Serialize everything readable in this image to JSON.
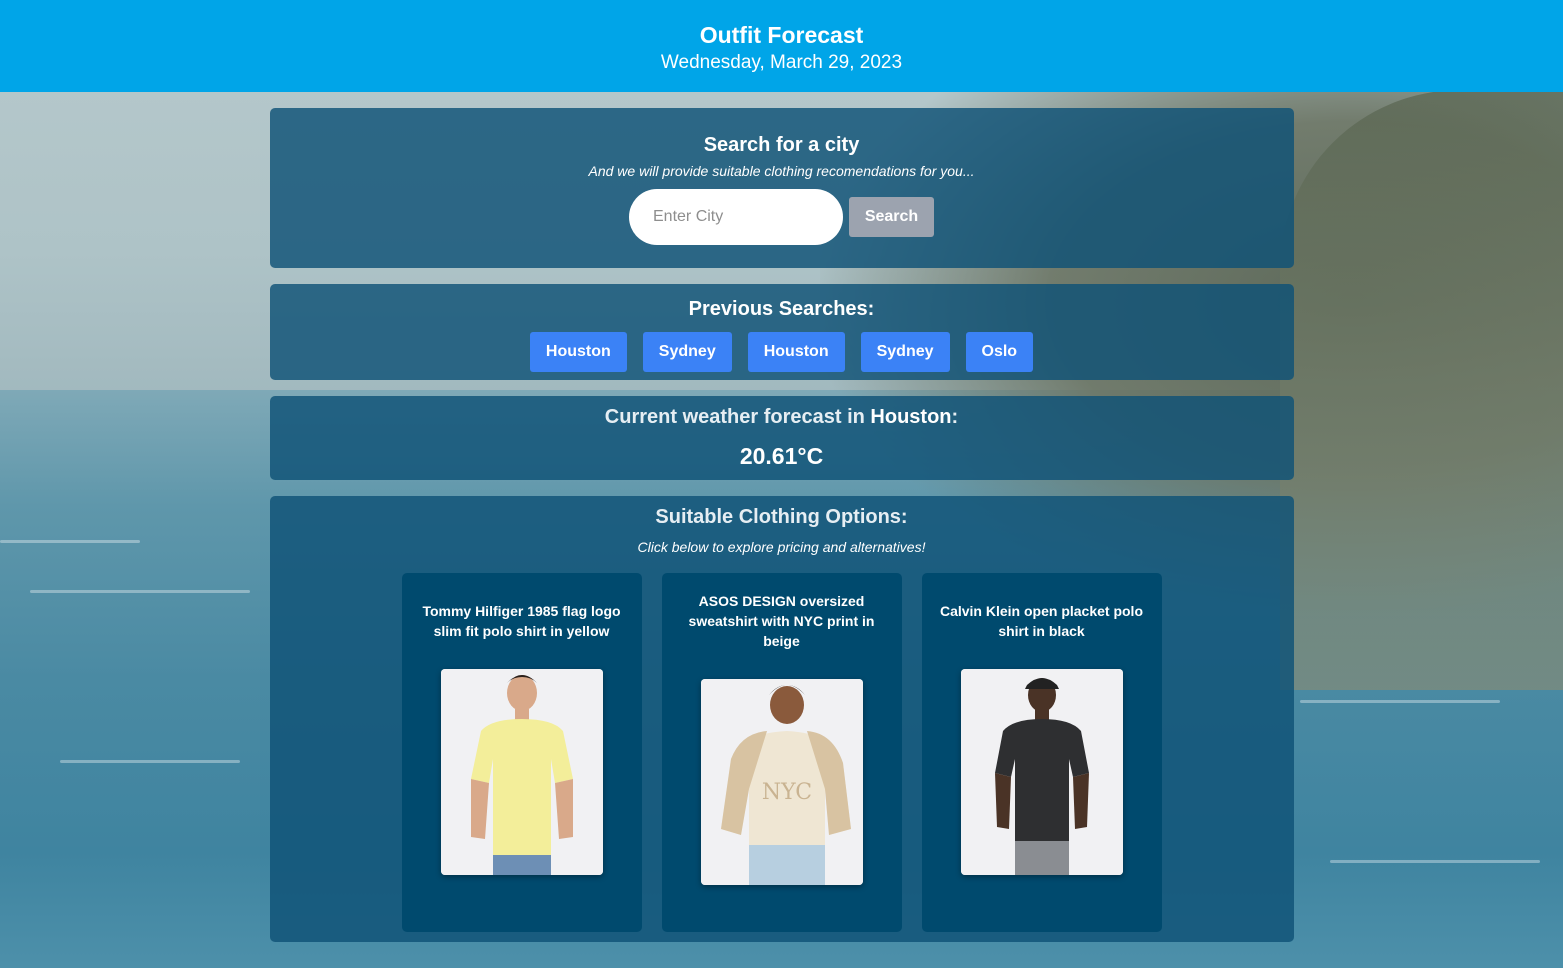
{
  "header": {
    "title": "Outfit Forecast",
    "date": "Wednesday, March 29, 2023"
  },
  "search": {
    "heading": "Search for a city",
    "subtitle": "And we will provide suitable clothing recomendations for you...",
    "placeholder": "Enter City",
    "button_label": "Search"
  },
  "previous": {
    "heading": "Previous Searches:",
    "cities": [
      "Houston",
      "Sydney",
      "Houston",
      "Sydney",
      "Oslo"
    ]
  },
  "weather": {
    "heading_prefix": "Current weather forecast in ",
    "city": "Houston",
    "heading_suffix": ":",
    "temperature": "20.61°C"
  },
  "clothing": {
    "heading": "Suitable Clothing Options:",
    "subtitle": "Click below to explore pricing and alternatives!",
    "items": [
      {
        "name": "Tommy Hilfiger 1985 flag logo slim fit polo shirt in yellow",
        "shirt_color": "#f3ee9a",
        "pants_color": "#6d8fb5"
      },
      {
        "name": "ASOS DESIGN oversized sweatshirt with NYC print in beige",
        "shirt_color": "#efe6d3",
        "pants_color": "#b7cfe0"
      },
      {
        "name": "Calvin Klein open placket polo shirt in black",
        "shirt_color": "#2e2f31",
        "pants_color": "#8a8d92"
      }
    ]
  },
  "colors": {
    "header_bg": "#00a5e8",
    "panel_bg": "#0f5276",
    "card_bg": "#004a6e",
    "city_button": "#3b82f6",
    "search_button": "#9ca3af"
  }
}
